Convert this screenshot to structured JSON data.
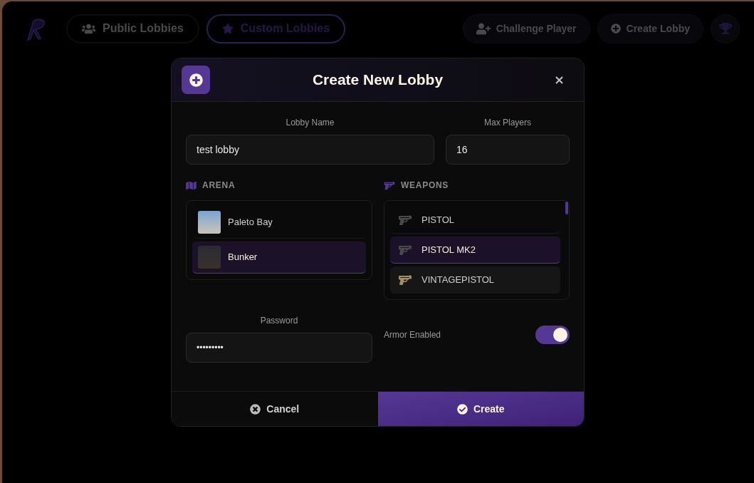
{
  "nav": {
    "tabs": [
      {
        "label": "Public Lobbies",
        "selected": false
      },
      {
        "label": "Custom Lobbies",
        "selected": true
      }
    ],
    "actions": [
      "Challenge Player",
      "Create Lobby"
    ]
  },
  "dialog": {
    "title": "Create New Lobby",
    "lobby_name": {
      "label": "Lobby Name",
      "value": "test lobby"
    },
    "max_players": {
      "label": "Max Players",
      "value": "16"
    },
    "arena": {
      "heading": "ARENA",
      "items": [
        {
          "name": "Paleto Bay",
          "selected": false
        },
        {
          "name": "Bunker",
          "selected": true
        }
      ]
    },
    "weapons": {
      "heading": "WEAPONS",
      "items": [
        {
          "name": "PISTOL",
          "selected": false
        },
        {
          "name": "PISTOL MK2",
          "selected": true
        },
        {
          "name": "VINTAGEPISTOL",
          "selected": false
        }
      ]
    },
    "password": {
      "label": "Password",
      "value": "•••••••••"
    },
    "armor": {
      "label": "Armor Enabled",
      "on": true
    },
    "buttons": {
      "cancel": "Cancel",
      "create": "Create"
    }
  }
}
